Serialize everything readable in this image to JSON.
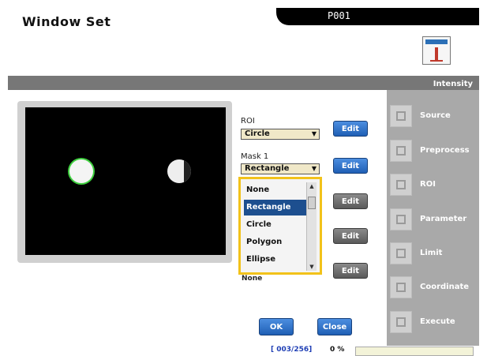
{
  "window": {
    "title": "Window Set",
    "program": "P001"
  },
  "breadcrumb": "Intensity",
  "settings": {
    "roi_label": "ROI",
    "roi_value": "Circle",
    "mask1_label": "Mask 1",
    "mask1_value": "Rectangle",
    "edit_label": "Edit",
    "partial_option": "None"
  },
  "dropdown": {
    "options": [
      "None",
      "Rectangle",
      "Circle",
      "Polygon",
      "Ellipse"
    ],
    "selected": "Rectangle"
  },
  "sidebar": {
    "items": [
      {
        "label": "Source",
        "icon": "source-icon"
      },
      {
        "label": "Preprocess",
        "icon": "preprocess-icon"
      },
      {
        "label": "ROI",
        "icon": "roi-icon"
      },
      {
        "label": "Parameter",
        "icon": "parameter-icon"
      },
      {
        "label": "Limit",
        "icon": "limit-icon"
      },
      {
        "label": "Coordinate",
        "icon": "coordinate-icon"
      },
      {
        "label": "Execute",
        "icon": "execute-icon"
      }
    ]
  },
  "actions": {
    "ok": "OK",
    "close": "Close"
  },
  "status": {
    "count": "[ 003/256]",
    "percent": "0 %"
  },
  "colors": {
    "accent": "#2b6fb6",
    "highlight": "#f2c21a",
    "selection": "#1d4f8f",
    "sidebar": "#a9a9a9"
  }
}
